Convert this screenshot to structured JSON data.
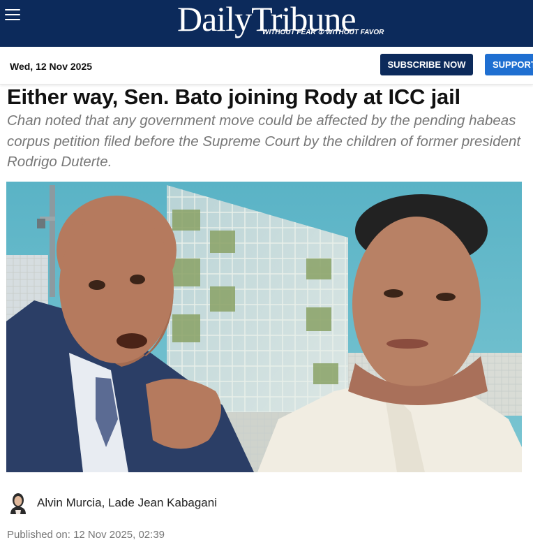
{
  "masthead": {
    "logo_text": "DailyTribune",
    "tagline": "WITHOUT FEAR ① WITHOUT FAVOR"
  },
  "datebar": {
    "date": "Wed, 12 Nov 2025",
    "subscribe_label": "SUBSCRIBE NOW",
    "support_label": "SUPPORT"
  },
  "article": {
    "headline": "Either way, Sen. Bato joining Rody at ICC jail",
    "dek": "Chan noted that any government move could be affected by the pending habeas corpus petition filed before the Supreme Court by the children of former president Rodrigo Duterte.",
    "authors": "Alvin Murcia, Lade Jean Kabagani",
    "published": "Published on: 12 Nov 2025, 02:39"
  },
  "colors": {
    "masthead_bg": "#0c2a5b",
    "subscribe_bg": "#0c2a5b",
    "support_bg": "#1f6fd1",
    "hero_sky": "#5fb6c7"
  },
  "icons": {
    "menu": "hamburger-menu-icon",
    "author": "author-avatar-icon"
  }
}
